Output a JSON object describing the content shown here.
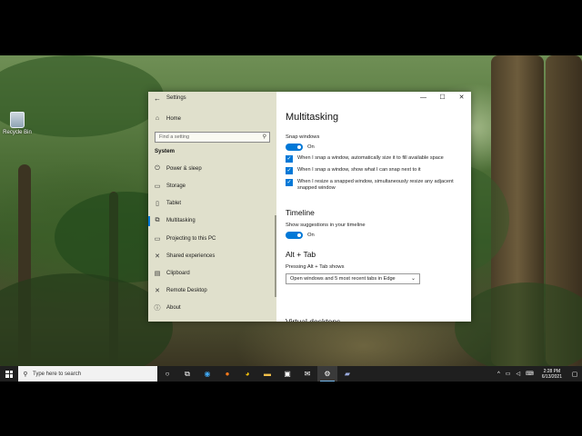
{
  "desktop": {
    "recycle_bin_label": "Recycle Bin"
  },
  "settings": {
    "title": "Settings",
    "back_icon": "←",
    "caption": {
      "minimize": "—",
      "maximize": "☐",
      "close": "✕"
    },
    "sidebar": {
      "home": {
        "icon": "⌂",
        "label": "Home"
      },
      "search_placeholder": "Find a setting",
      "section_header": "System",
      "items": [
        {
          "icon": "⏻",
          "label": "Power & sleep",
          "active": false
        },
        {
          "icon": "▭",
          "label": "Storage",
          "active": false
        },
        {
          "icon": "▯",
          "label": "Tablet",
          "active": false
        },
        {
          "icon": "⧉",
          "label": "Multitasking",
          "active": true
        },
        {
          "icon": "▭",
          "label": "Projecting to this PC",
          "active": false
        },
        {
          "icon": "✕",
          "label": "Shared experiences",
          "active": false
        },
        {
          "icon": "▤",
          "label": "Clipboard",
          "active": false
        },
        {
          "icon": "✕",
          "label": "Remote Desktop",
          "active": false
        },
        {
          "icon": "ⓘ",
          "label": "About",
          "active": false
        }
      ]
    },
    "main": {
      "page_title": "Multitasking",
      "snap": {
        "label": "Snap windows",
        "toggle_state": "On",
        "options": [
          "When I snap a window, automatically size it to fill available space",
          "When I snap a window, show what I can snap next to it",
          "When I resize a snapped window, simultaneously resize any adjacent snapped window"
        ]
      },
      "timeline": {
        "heading": "Timeline",
        "label": "Show suggestions in your timeline",
        "toggle_state": "On"
      },
      "alttab": {
        "heading": "Alt + Tab",
        "label": "Pressing Alt + Tab shows",
        "selected": "Open windows and 5 most recent tabs in Edge"
      },
      "cut_heading": "Virtual desktops"
    }
  },
  "taskbar": {
    "search_placeholder": "Type here to search",
    "clock_time": "2:28 PM",
    "clock_date": "6/13/2021",
    "accent": "#0078d7"
  }
}
